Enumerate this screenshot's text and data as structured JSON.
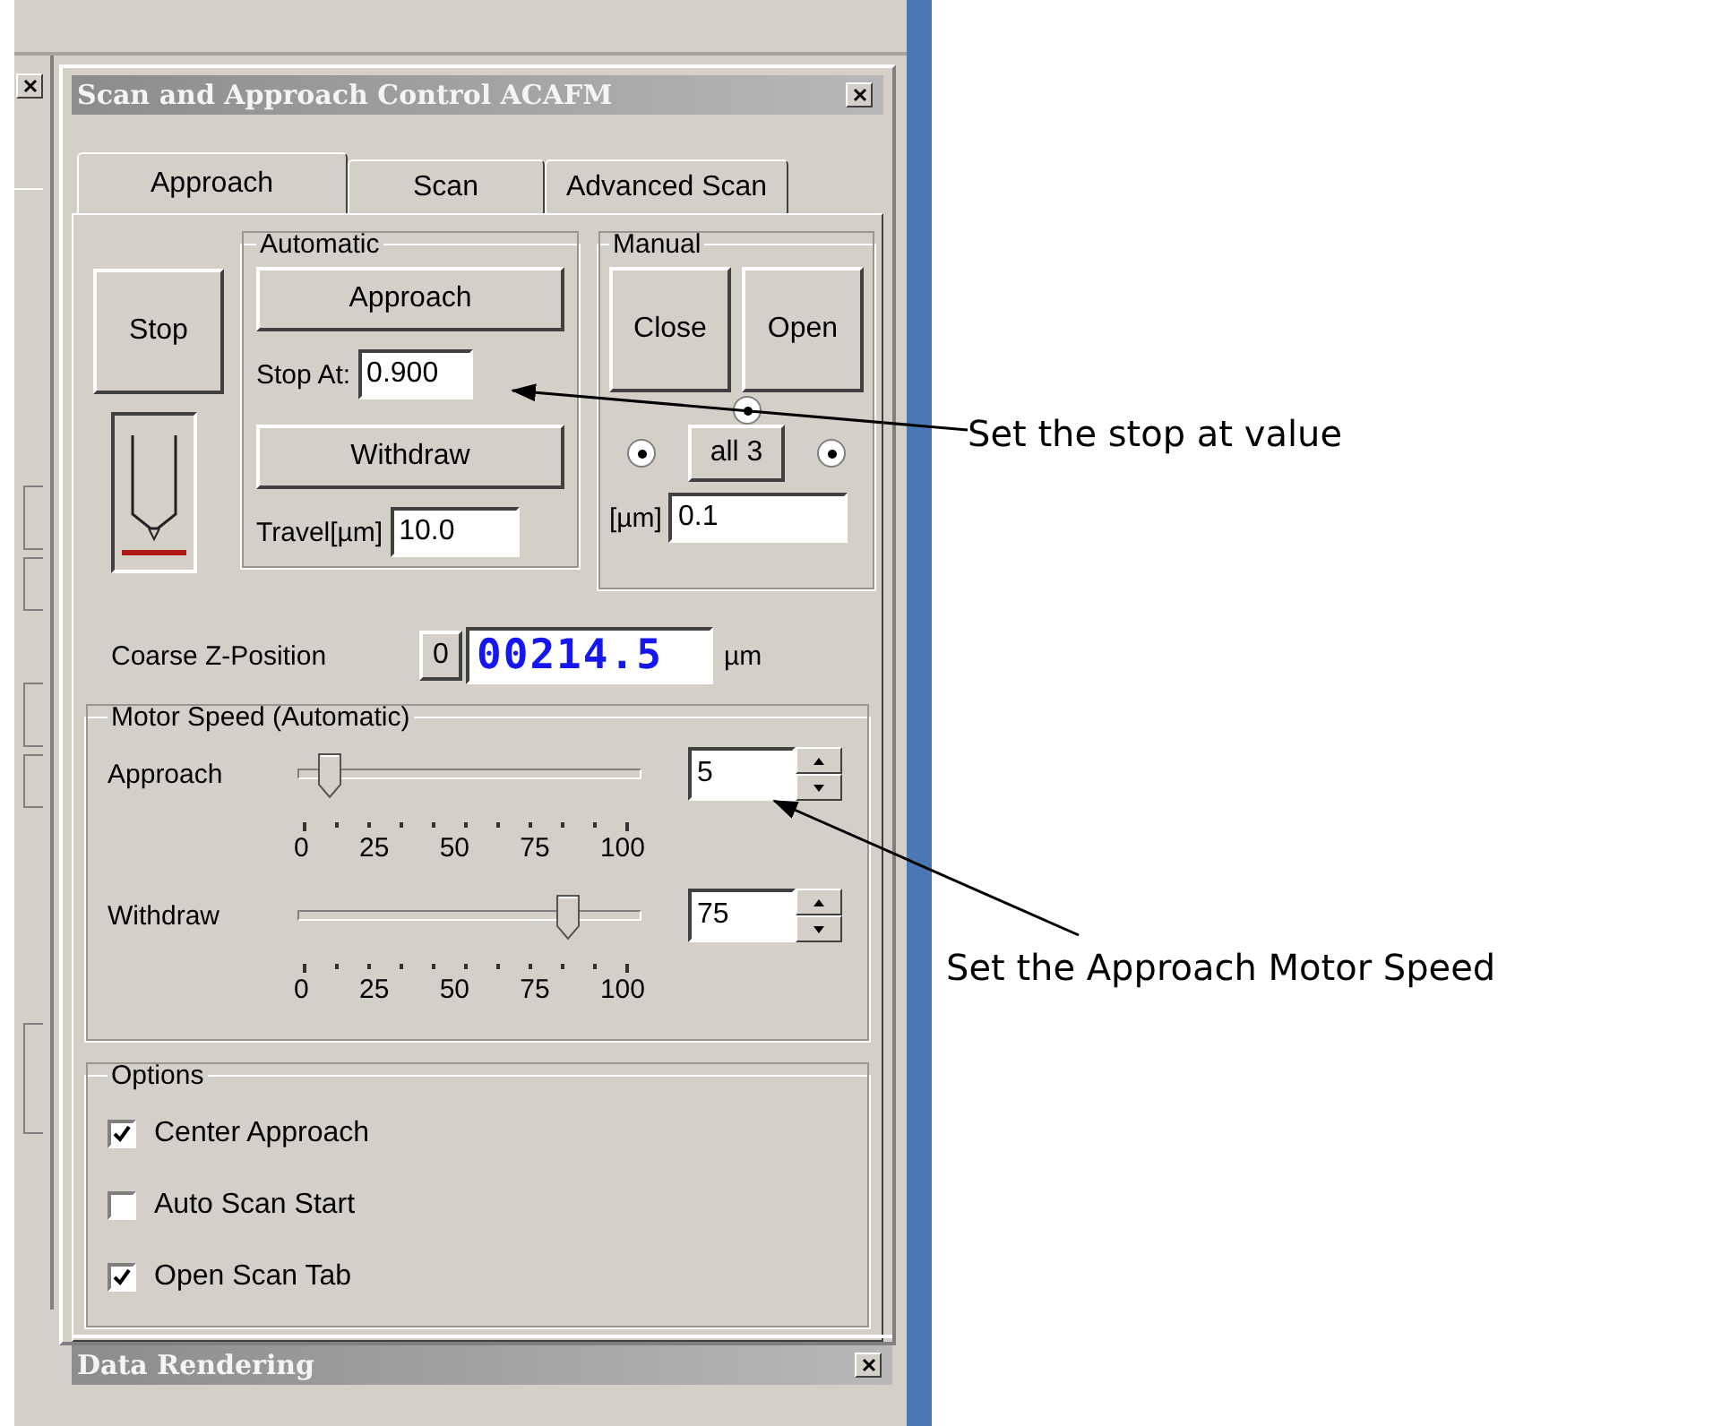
{
  "window": {
    "title": "Scan and Approach Control ACAFM"
  },
  "tabs": [
    {
      "label": "Approach",
      "selected": true
    },
    {
      "label": "Scan",
      "selected": false
    },
    {
      "label": "Advanced Scan",
      "selected": false
    }
  ],
  "stop_button": "Stop",
  "automatic": {
    "title": "Automatic",
    "approach_button": "Approach",
    "stop_at": {
      "label": "Stop At:",
      "value": "0.900"
    },
    "withdraw_button": "Withdraw",
    "travel": {
      "label": "Travel[µm]",
      "value": "10.0"
    }
  },
  "manual": {
    "title": "Manual",
    "buttons": [
      "Close",
      "Open"
    ],
    "radios": [
      {
        "checked": true
      },
      {
        "checked": true
      },
      {
        "checked": true
      }
    ],
    "all_button": "all 3",
    "step": {
      "label": "[µm]",
      "value": "0.1"
    }
  },
  "coarse_z": {
    "label": "Coarse Z-Position",
    "zero_button": "0",
    "value": "00214.5",
    "unit": "µm"
  },
  "motor_speed": {
    "title": "Motor Speed (Automatic)",
    "sliders": [
      {
        "label": "Approach",
        "level": 0.05,
        "value": "5",
        "ticks": [
          "0",
          "25",
          "50",
          "75",
          "100"
        ]
      },
      {
        "label": "Withdraw",
        "level": 0.75,
        "value": "75",
        "ticks": [
          "0",
          "25",
          "50",
          "75",
          "100"
        ]
      }
    ]
  },
  "options": {
    "title": "Options",
    "items": [
      {
        "label": "Center Approach",
        "checked": true
      },
      {
        "label": "Auto Scan Start",
        "checked": false
      },
      {
        "label": "Open Scan Tab",
        "checked": true
      }
    ]
  },
  "bottom_window": {
    "title": "Data Rendering"
  },
  "annotations": [
    {
      "text": "Set the stop at value"
    },
    {
      "text": "Set the Approach Motor Speed"
    }
  ]
}
